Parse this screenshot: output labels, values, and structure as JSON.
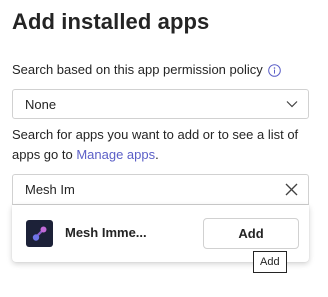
{
  "header": {
    "title": "Add installed apps"
  },
  "policy": {
    "label": "Search based on this app permission policy",
    "info_icon": "info-icon",
    "selected_value": "None",
    "dropdown_icon": "chevron-down-icon"
  },
  "help": {
    "text_before_link": "Search for apps you want to add or to see a list of apps go to ",
    "link_text": "Manage apps",
    "text_after_link": "."
  },
  "search": {
    "value": "Mesh Im",
    "clear_icon": "close-icon"
  },
  "results": [
    {
      "name": "Mesh Imme...",
      "icon": "mesh-app-icon",
      "action_label": "Add"
    }
  ],
  "tooltip": {
    "text": "Add"
  },
  "colors": {
    "link": "#5b5fc7",
    "text": "#242424",
    "border": "#d1d1d1",
    "app_icon_bg": "#1c2138",
    "app_icon_accent": "#c36bd8"
  }
}
